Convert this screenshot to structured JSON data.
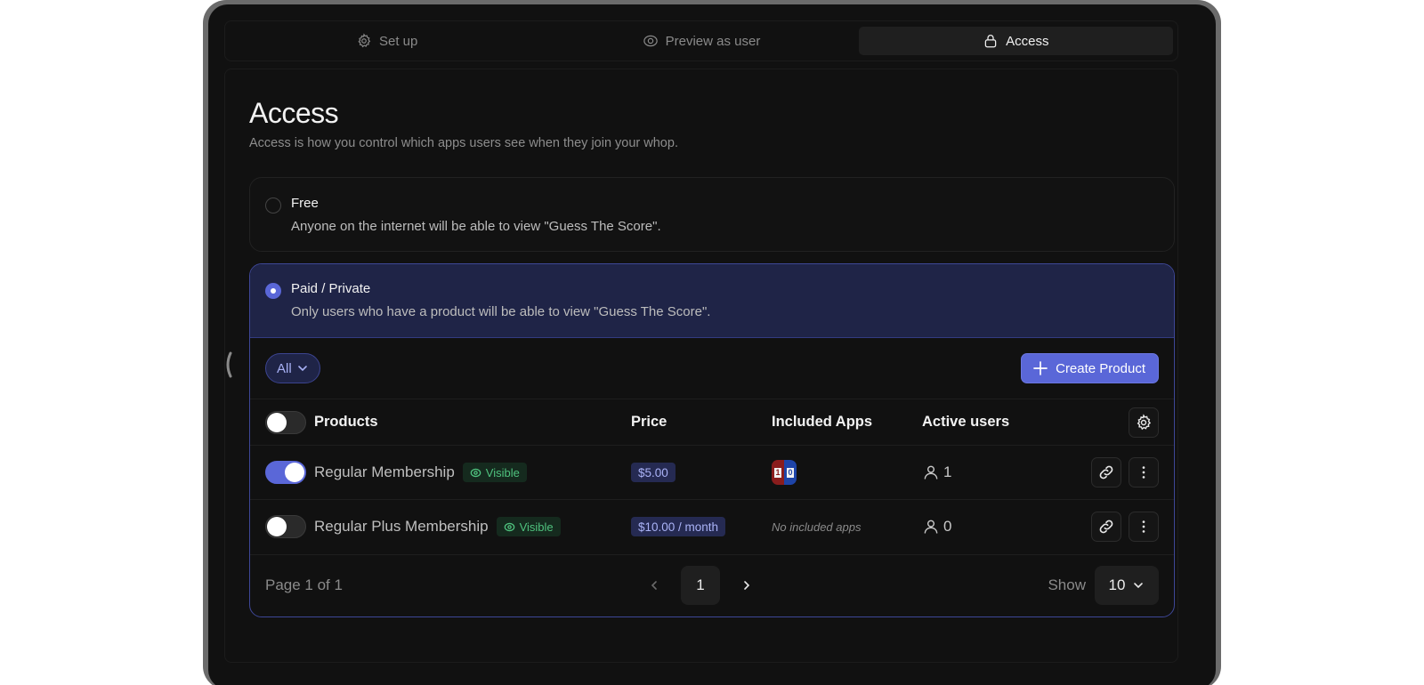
{
  "tabs": [
    {
      "label": "Set up",
      "icon": "gear-icon",
      "active": false
    },
    {
      "label": "Preview as user",
      "icon": "eye-icon",
      "active": false
    },
    {
      "label": "Access",
      "icon": "lock-icon",
      "active": true
    }
  ],
  "page": {
    "title": "Access",
    "subtitle": "Access is how you control which apps users see when they join your whop."
  },
  "options": {
    "free": {
      "title": "Free",
      "description": "Anyone on the internet will be able to view \"Guess The Score\".",
      "selected": false
    },
    "paid": {
      "title": "Paid / Private",
      "description": "Only users who have a product will be able to view \"Guess The Score\".",
      "selected": true
    }
  },
  "toolbar": {
    "filter_label": "All",
    "create_label": "Create Product"
  },
  "table": {
    "headers": {
      "products": "Products",
      "price": "Price",
      "apps": "Included Apps",
      "users": "Active users"
    },
    "rows": [
      {
        "name": "Regular Membership",
        "enabled": true,
        "visibility": "Visible",
        "price": "$5.00",
        "apps": [
          "Guess The Score"
        ],
        "apps_text": "",
        "active_users": "1"
      },
      {
        "name": "Regular Plus Membership",
        "enabled": false,
        "visibility": "Visible",
        "price": "$10.00 / month",
        "apps": [],
        "apps_text": "No included apps",
        "active_users": "0"
      }
    ]
  },
  "pagination": {
    "label": "Page 1 of 1",
    "current_page": "1",
    "show_label": "Show",
    "page_size": "10"
  },
  "colors": {
    "accent": "#5a67d8",
    "selected_bg": "#1f2447",
    "visible_green": "#4fc27e",
    "background": "#111111"
  }
}
